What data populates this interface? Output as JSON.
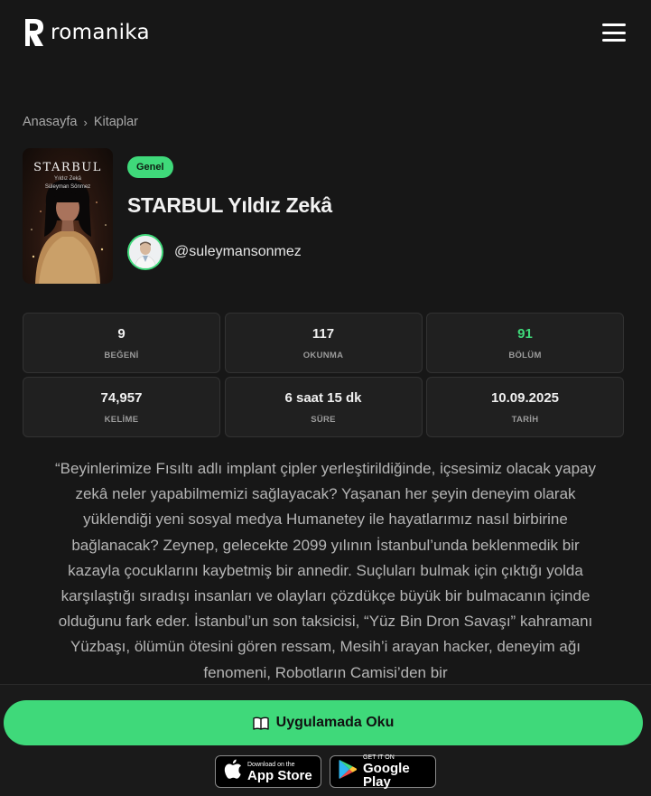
{
  "header": {
    "logo_text": "romanika",
    "menu_icon": "hamburger-icon"
  },
  "breadcrumb": {
    "items": [
      "Anasayfa",
      "Kitaplar"
    ],
    "separator": "›"
  },
  "book": {
    "cover": {
      "title": "STARBUL",
      "subtitle": "Yıldız Zekâ",
      "author": "Süleyman Sönmez"
    },
    "category": "Genel",
    "title": "STARBUL Yıldız Zekâ",
    "author_handle": "@suleymansonmez"
  },
  "stats": [
    {
      "value": "9",
      "label": "BEĞENİ"
    },
    {
      "value": "117",
      "label": "OKUNMA"
    },
    {
      "value": "91",
      "label": "BÖLÜM"
    },
    {
      "value": "74,957",
      "label": "KELİME"
    },
    {
      "value": "6 saat 15 dk",
      "label": "SÜRE"
    },
    {
      "value": "10.09.2025",
      "label": "TARİH"
    }
  ],
  "description": "“Beyinlerimize Fısıltı adlı implant çipler yerleştirildiğinde, içsesimiz olacak yapay zekâ neler yapabilmemizi sağlayacak? Yaşanan her şeyin deneyim olarak yüklendiği yeni sosyal medya Humanetey ile hayatlarımız nasıl birbirine bağlanacak? Zeynep, gelecekte 2099 yılının İstanbul’unda beklenmedik bir kazayla çocuklarını kaybetmiş bir annedir. Suçluları bulmak için çıktığı yolda karşılaştığı sıradışı insanları ve olayları çözdükçe büyük bir bulmacanın içinde olduğunu fark eder. İstanbul’un son taksicisi, “Yüz Bin Dron Savaşı” kahramanı Yüzbaşı, ölümün ötesini gören ressam, Mesih’i arayan hacker, deneyim ağı fenomeni, Robotların Camisi’den bir",
  "actions": {
    "read_button": "Uygulamada Oku",
    "app_store_small": "Download on the",
    "app_store_big": "App Store",
    "google_play_small": "GET IT ON",
    "google_play_big": "Google Play"
  },
  "colors": {
    "accent": "#3fd97a",
    "background": "#171717",
    "card": "#202020"
  }
}
